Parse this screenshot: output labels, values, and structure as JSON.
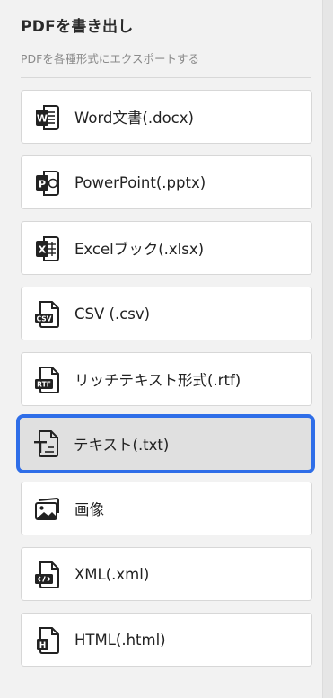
{
  "panel": {
    "title": "PDFを書き出し",
    "subtitle": "PDFを各種形式にエクスポートする"
  },
  "formats": [
    {
      "label": "Word文書(.docx)",
      "icon": "word-icon"
    },
    {
      "label": "PowerPoint(.pptx)",
      "icon": "powerpoint-icon"
    },
    {
      "label": "Excelブック(.xlsx)",
      "icon": "excel-icon"
    },
    {
      "label": "CSV (.csv)",
      "icon": "csv-file-icon"
    },
    {
      "label": "リッチテキスト形式(.rtf)",
      "icon": "rtf-file-icon"
    },
    {
      "label": "テキスト(.txt)",
      "icon": "text-file-icon",
      "selected": true
    },
    {
      "label": "画像",
      "icon": "image-icon"
    },
    {
      "label": "XML(.xml)",
      "icon": "xml-file-icon"
    },
    {
      "label": "HTML(.html)",
      "icon": "html-file-icon"
    }
  ],
  "colors": {
    "selection_border": "#2f6ee8",
    "selected_background": "#e0e0e0"
  }
}
